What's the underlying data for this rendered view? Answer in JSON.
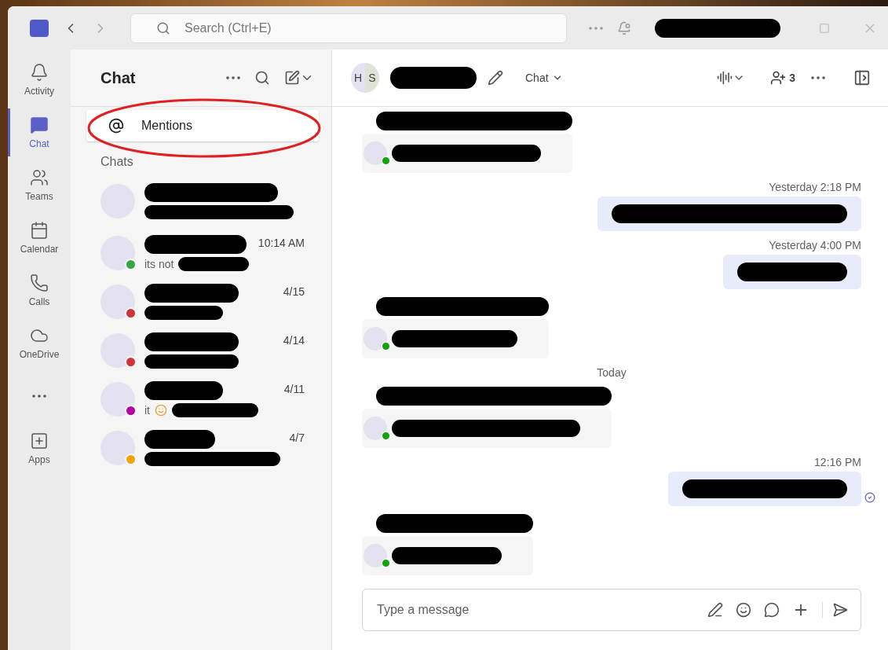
{
  "window": {
    "search_placeholder": "Search (Ctrl+E)"
  },
  "rail": [
    {
      "label": "Activity",
      "selected": false
    },
    {
      "label": "Chat",
      "selected": true
    },
    {
      "label": "Teams",
      "selected": false
    },
    {
      "label": "Calendar",
      "selected": false
    },
    {
      "label": "Calls",
      "selected": false
    },
    {
      "label": "OneDrive",
      "selected": false
    },
    {
      "selected": false
    },
    {
      "label": "Apps",
      "selected": false
    }
  ],
  "chat_list": {
    "title": "Chat",
    "mentions": "Mentions",
    "section": "Chats",
    "items": [
      {
        "emoji": false
      },
      {
        "time": "10:14 AM",
        "preview": "its not",
        "color": "#3aa545",
        "emoji": false
      },
      {
        "time": "4/15",
        "color": "#d13438",
        "emoji": false
      },
      {
        "time": "4/14",
        "color": "#d13438",
        "emoji": false
      },
      {
        "time": "4/11",
        "preview": "it",
        "emoji": true,
        "color": "#b4009e"
      },
      {
        "time": "4/7",
        "color": "#f0a30a",
        "emoji": false
      }
    ]
  },
  "conversation": {
    "initials": [
      "H",
      "S"
    ],
    "view": "Chat",
    "participants": "3",
    "messages": [
      {
        "kind": "incoming",
        "color": "#13a10e"
      },
      {
        "kind": "outgoing",
        "time": "Yesterday 2:18 PM",
        "seen": false
      },
      {
        "kind": "outgoing",
        "time": "Yesterday 4:00 PM",
        "seen": false
      },
      {
        "kind": "incoming",
        "color": "#13a10e"
      },
      {
        "kind": "separator",
        "label": "Today"
      },
      {
        "kind": "incoming",
        "color": "#13a10e"
      },
      {
        "kind": "outgoing",
        "time": "12:16 PM",
        "seen": true
      },
      {
        "kind": "incoming",
        "color": "#13a10e"
      }
    ],
    "compose_placeholder": "Type a message"
  }
}
